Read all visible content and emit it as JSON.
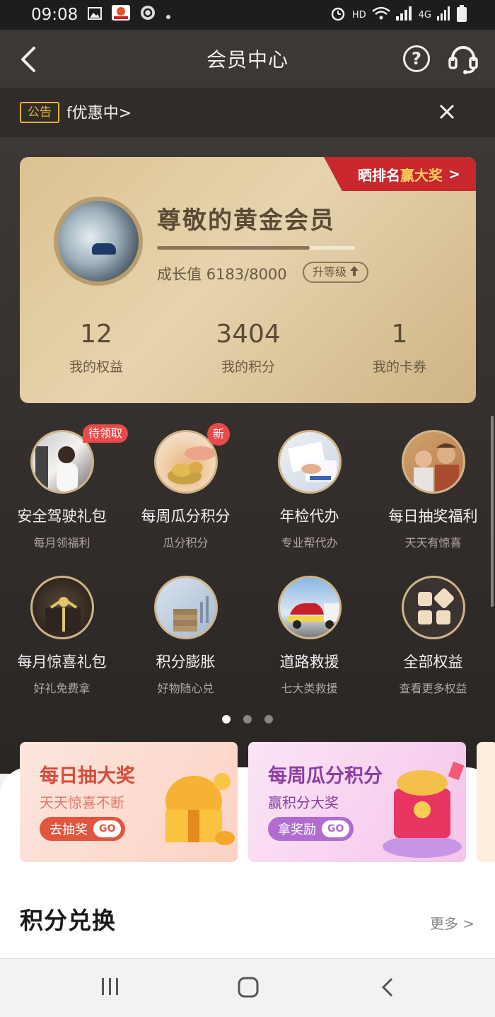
{
  "status_bar": {
    "time": "09:08",
    "network": "HD",
    "signal_label": "4G"
  },
  "header": {
    "title": "会员中心",
    "back_icon": "chevron-left-icon",
    "help_icon": "question-circle-icon",
    "help_glyph": "?",
    "service_icon": "headset-icon"
  },
  "notice": {
    "tag": "公告",
    "text": "f优惠中>",
    "close_icon": "close-icon"
  },
  "member_card": {
    "rank_prefix": "晒排名",
    "rank_highlight": "赢大奖",
    "rank_arrow": ">",
    "title": "尊敬的黄金会员",
    "growth_label": "成长值",
    "growth_value": "6183/8000",
    "growth_progress": 0.77,
    "upgrade_label": "升等级",
    "stats": [
      {
        "value": "12",
        "label": "我的权益"
      },
      {
        "value": "3404",
        "label": "我的积分"
      },
      {
        "value": "1",
        "label": "我的卡券"
      }
    ]
  },
  "benefits": [
    {
      "name": "安全驾驶礼包",
      "sub": "每月领福利",
      "badge": "待领取",
      "icon": "driver-photo"
    },
    {
      "name": "每周瓜分积分",
      "sub": "瓜分积分",
      "badge": "新",
      "icon": "coins-photo"
    },
    {
      "name": "年检代办",
      "sub": "专业帮代办",
      "badge": "",
      "icon": "documents-photo"
    },
    {
      "name": "每日抽奖福利",
      "sub": "天天有惊喜",
      "badge": "",
      "icon": "people-photo"
    },
    {
      "name": "每月惊喜礼包",
      "sub": "好礼免费拿",
      "badge": "",
      "icon": "gift-photo"
    },
    {
      "name": "积分膨胀",
      "sub": "好物随心兑",
      "badge": "",
      "icon": "coin-stack-photo"
    },
    {
      "name": "道路救援",
      "sub": "七大类救援",
      "badge": "",
      "icon": "tow-truck-photo"
    },
    {
      "name": "全部权益",
      "sub": "查看更多权益",
      "badge": "",
      "icon": "grid-icon"
    }
  ],
  "pager": {
    "count": 3,
    "active": 0
  },
  "banners": [
    {
      "title": "每日抽大奖",
      "subtitle": "天天惊喜不断",
      "button": "去抽奖",
      "go": "GO"
    },
    {
      "title": "每周瓜分积分",
      "subtitle": "赢积分大奖",
      "button": "拿奖励",
      "go": "GO"
    }
  ],
  "exchange": {
    "title": "积分兑换",
    "more": "更多 >"
  },
  "navbar": {
    "recent_icon": "recent-apps-icon",
    "home_icon": "home-icon",
    "back_icon": "back-icon"
  },
  "colors": {
    "accent_gold": "#e6b53a",
    "badge_red": "#e84a4a",
    "card_gold": "#dcc291"
  }
}
